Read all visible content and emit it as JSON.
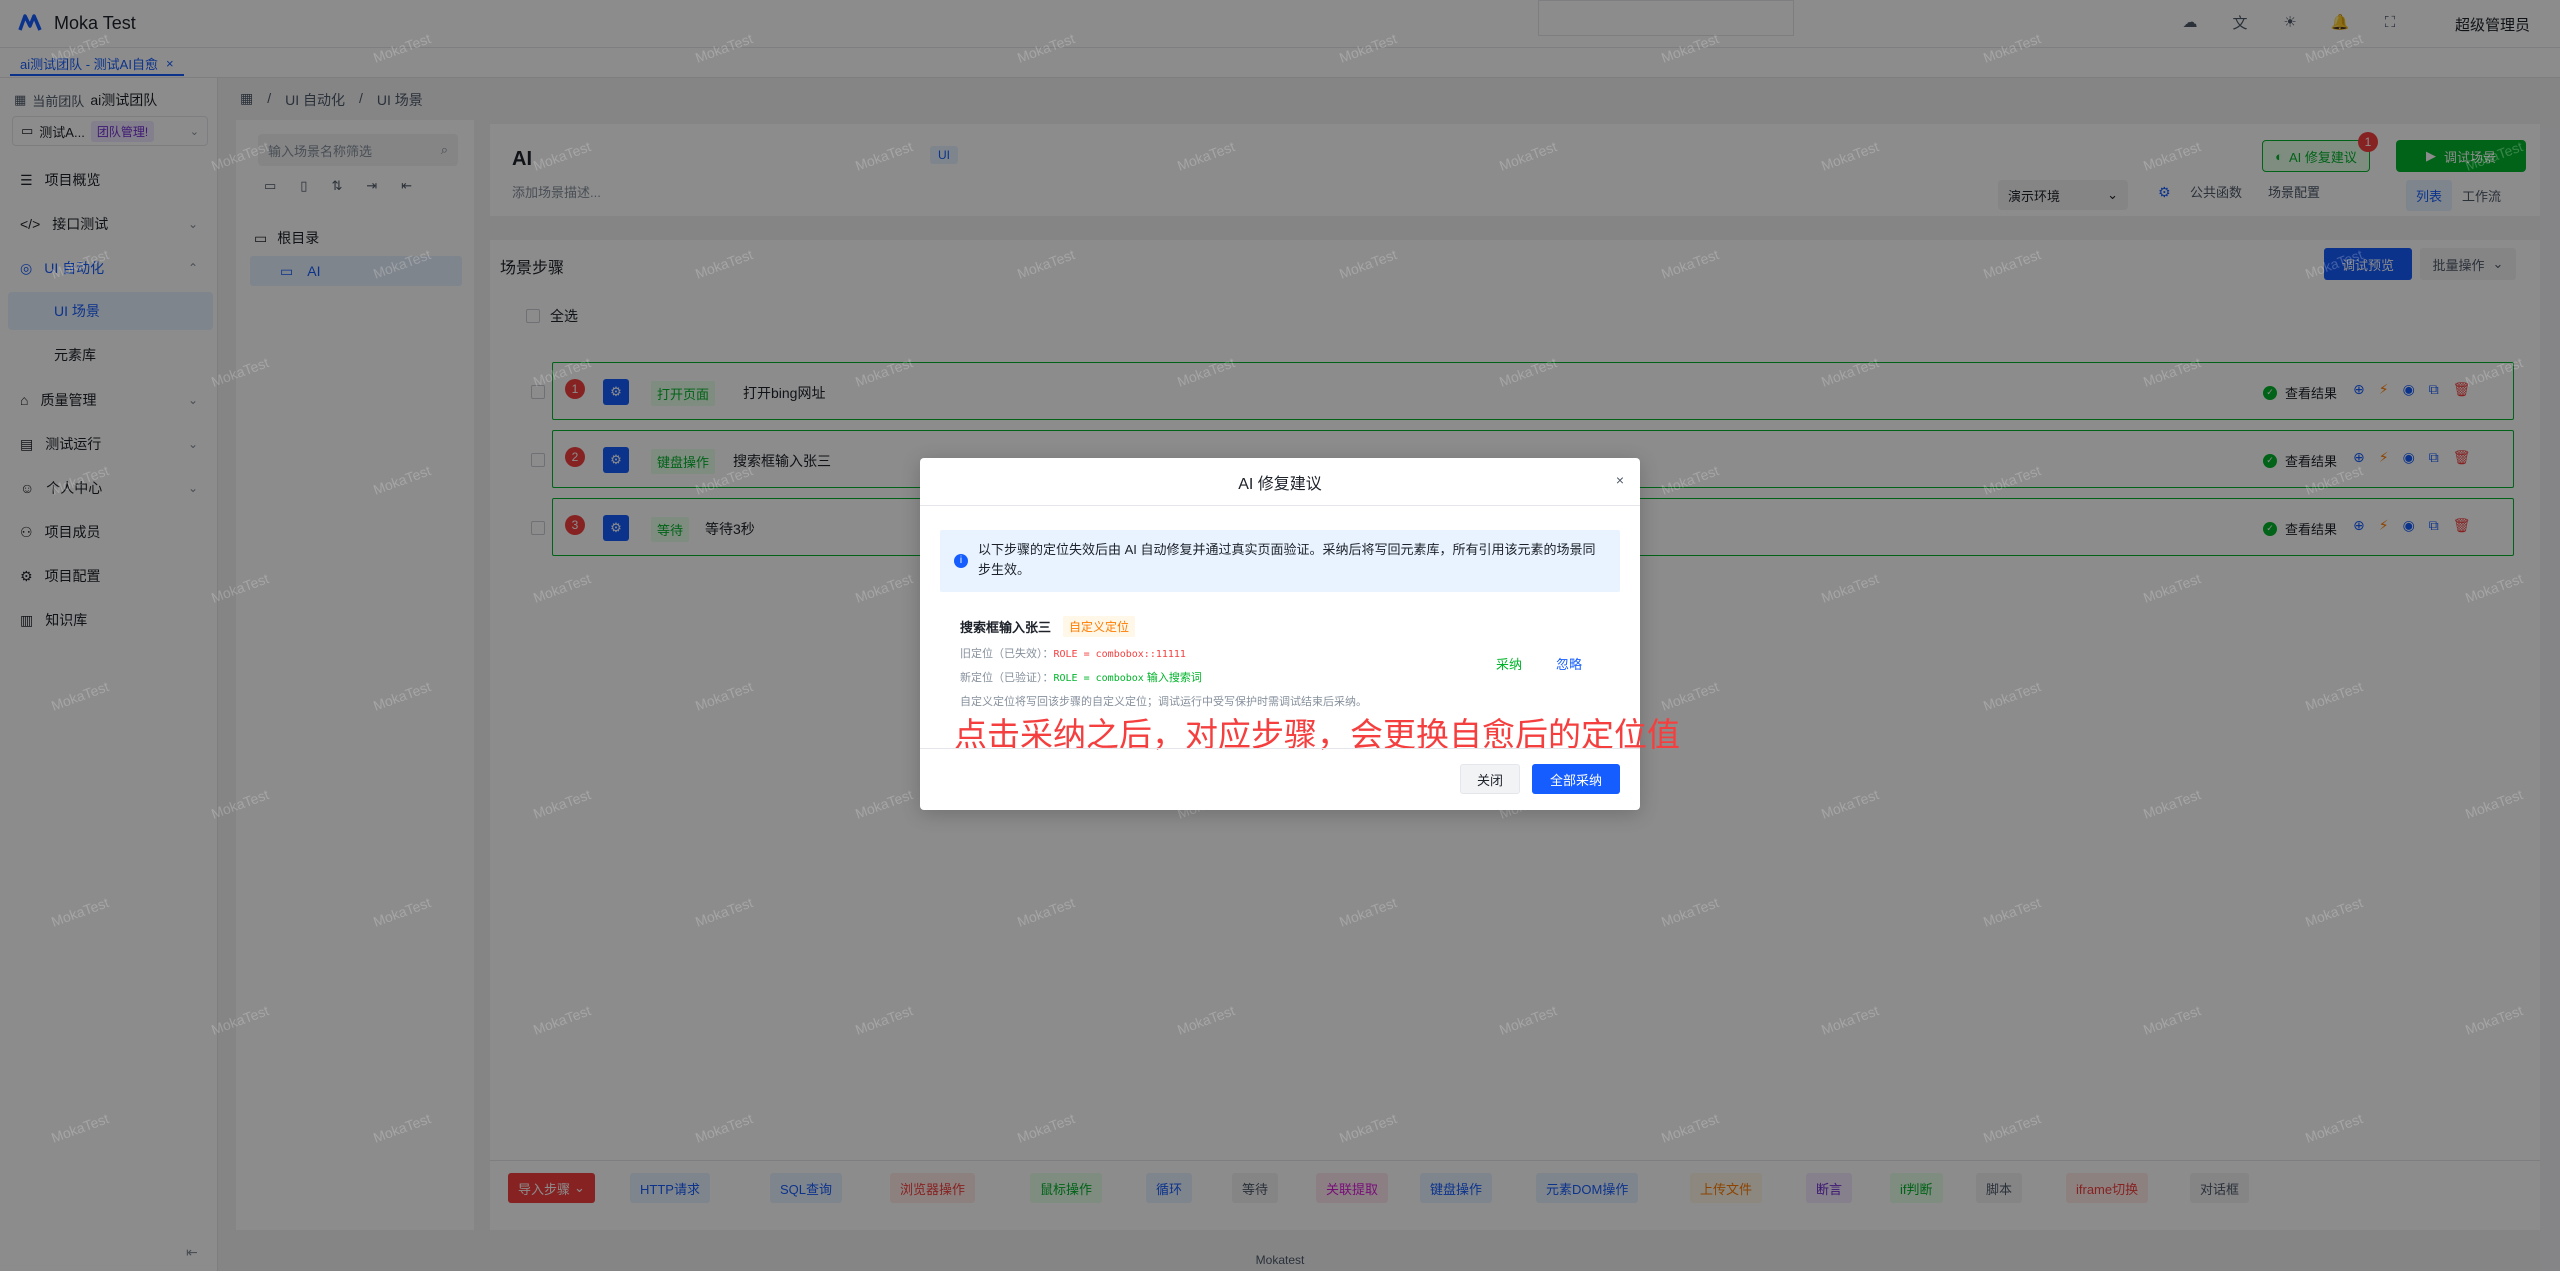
{
  "app": {
    "title": "Moka Test",
    "user": "超级管理员",
    "footer": "Mokatest",
    "watermark": "MokaTest"
  },
  "header_icons": [
    "cloud-icon",
    "translate-icon",
    "sun-icon",
    "bell-icon",
    "fullscreen-icon"
  ],
  "tabs": [
    {
      "label": "ai测试团队 - 测试AI自愈"
    }
  ],
  "sidebar": {
    "team_label": "当前团队",
    "team_name": "ai测试团队",
    "project": "测试A...",
    "project_badge": "团队管理!",
    "items": [
      {
        "label": "项目概览"
      },
      {
        "label": "接口测试"
      },
      {
        "label": "UI 自动化"
      },
      {
        "label": "UI 场景"
      },
      {
        "label": "元素库"
      },
      {
        "label": "质量管理"
      },
      {
        "label": "测试运行"
      },
      {
        "label": "个人中心"
      },
      {
        "label": "项目成员"
      },
      {
        "label": "项目配置"
      },
      {
        "label": "知识库"
      }
    ]
  },
  "breadcrumb": [
    "UI 自动化",
    "UI 场景"
  ],
  "tree": {
    "search_placeholder": "输入场景名称筛选",
    "root": "根目录",
    "node": "AI"
  },
  "scenario": {
    "title": "AI",
    "tag": "UI",
    "desc_placeholder": "添加场景描述...",
    "ai_fix_label": "AI 修复建议",
    "ai_fix_count": "1",
    "debug_label": "调试场景",
    "env": "演示环境",
    "links": [
      "公共函数",
      "场景配置"
    ],
    "view_modes": [
      "列表",
      "工作流"
    ]
  },
  "steps": {
    "title": "场景步骤",
    "preview_label": "调试预览",
    "batch_label": "批量操作",
    "select_all": "全选",
    "result_label": "查看结果",
    "items": [
      {
        "num": "1",
        "tag": "打开页面",
        "name": "打开bing网址"
      },
      {
        "num": "2",
        "tag": "键盘操作",
        "name": "搜索框输入张三"
      },
      {
        "num": "3",
        "tag": "等待",
        "name": "等待3秒"
      }
    ]
  },
  "toolbar": [
    "导入步骤",
    "HTTP请求",
    "SQL查询",
    "浏览器操作",
    "鼠标操作",
    "循环",
    "等待",
    "关联提取",
    "键盘操作",
    "元素DOM操作",
    "上传文件",
    "断言",
    "if判断",
    "脚本",
    "iframe切换",
    "对话框"
  ],
  "modal": {
    "title": "AI 修复建议",
    "info": "以下步骤的定位失效后由 AI 自动修复并通过真实页面验证。采纳后将写回元素库，所有引用该元素的场景同步生效。",
    "item_title": "搜索框输入张三",
    "item_tag": "自定义定位",
    "old_label": "旧定位（已失效）：",
    "old_value": "ROLE = combobox::11111",
    "new_label": "新定位（已验证）：",
    "new_value": "ROLE = combobox",
    "new_suffix": "输入搜索词",
    "note": "自定义定位将写回该步骤的自定义定位；调试运行中受写保护时需调试结束后采纳。",
    "adopt": "采纳",
    "ignore": "忽略",
    "annotation": "点击采纳之后，对应步骤，会更换自愈后的定位值",
    "close": "关闭",
    "adopt_all": "全部采纳"
  },
  "colors": {
    "primary": "#165dff",
    "success": "#00b42a",
    "danger": "#f53f3f",
    "warning": "#ff7d00"
  }
}
